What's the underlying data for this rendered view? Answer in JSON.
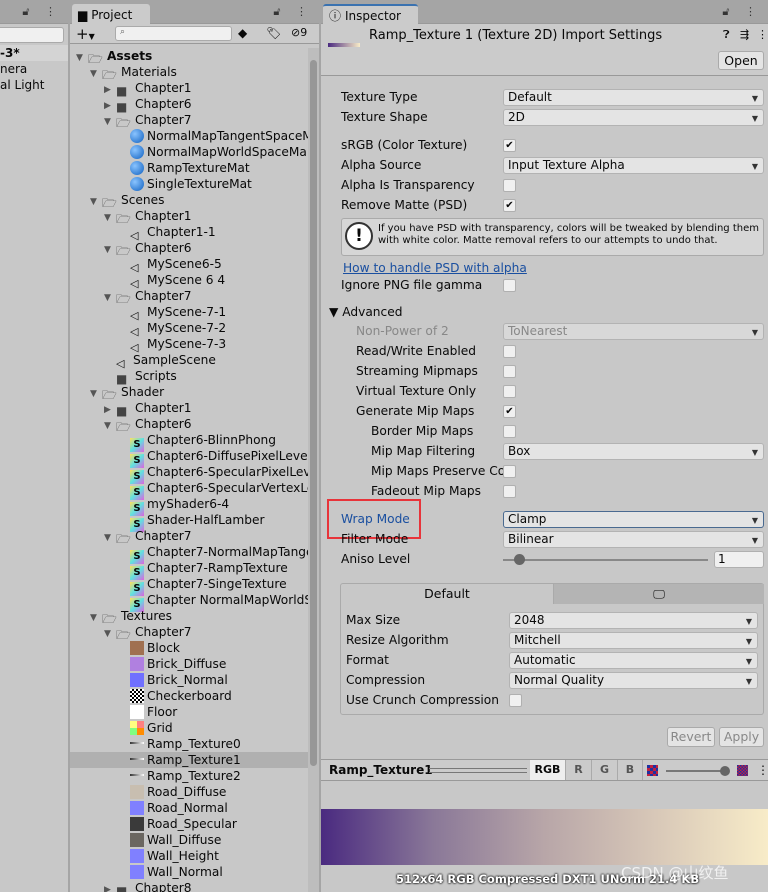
{
  "hierarchy": {
    "rows": [
      "-3*",
      "nera",
      "al Light"
    ]
  },
  "project": {
    "tab": "Project",
    "hidden_count": "9",
    "search_placeholder": "",
    "tree": [
      {
        "l": 0,
        "n": "Assets",
        "k": "folder",
        "o": true,
        "b": true
      },
      {
        "l": 1,
        "n": "Materials",
        "k": "folder",
        "o": true
      },
      {
        "l": 2,
        "n": "Chapter1",
        "k": "folder",
        "o": false
      },
      {
        "l": 2,
        "n": "Chapter6",
        "k": "folder",
        "o": false
      },
      {
        "l": 2,
        "n": "Chapter7",
        "k": "folder",
        "o": true
      },
      {
        "l": 3,
        "n": "NormalMapTangentSpaceM",
        "k": "mat"
      },
      {
        "l": 3,
        "n": "NormalMapWorldSpaceMa",
        "k": "mat"
      },
      {
        "l": 3,
        "n": "RampTextureMat",
        "k": "mat"
      },
      {
        "l": 3,
        "n": "SingleTextureMat",
        "k": "mat"
      },
      {
        "l": 1,
        "n": "Scenes",
        "k": "folder",
        "o": true
      },
      {
        "l": 2,
        "n": "Chapter1",
        "k": "folder",
        "o": true
      },
      {
        "l": 3,
        "n": "Chapter1-1",
        "k": "scene"
      },
      {
        "l": 2,
        "n": "Chapter6",
        "k": "folder",
        "o": true
      },
      {
        "l": 3,
        "n": "MyScene6-5",
        "k": "scene"
      },
      {
        "l": 3,
        "n": "MyScene 6 4",
        "k": "scene"
      },
      {
        "l": 2,
        "n": "Chapter7",
        "k": "folder",
        "o": true
      },
      {
        "l": 3,
        "n": "MyScene-7-1",
        "k": "scene"
      },
      {
        "l": 3,
        "n": "MyScene-7-2",
        "k": "scene"
      },
      {
        "l": 3,
        "n": "MyScene-7-3",
        "k": "scene"
      },
      {
        "l": 2,
        "n": "SampleScene",
        "k": "scene"
      },
      {
        "l": 2,
        "n": "Scripts",
        "k": "folder"
      },
      {
        "l": 1,
        "n": "Shader",
        "k": "folder",
        "o": true
      },
      {
        "l": 2,
        "n": "Chapter1",
        "k": "folder",
        "o": false
      },
      {
        "l": 2,
        "n": "Chapter6",
        "k": "folder",
        "o": true
      },
      {
        "l": 3,
        "n": "Chapter6-BlinnPhong",
        "k": "shader"
      },
      {
        "l": 3,
        "n": "Chapter6-DiffusePixelLevel",
        "k": "shader"
      },
      {
        "l": 3,
        "n": "Chapter6-SpecularPixelLeve",
        "k": "shader"
      },
      {
        "l": 3,
        "n": "Chapter6-SpecularVertexLev",
        "k": "shader"
      },
      {
        "l": 3,
        "n": "myShader6-4",
        "k": "shader"
      },
      {
        "l": 3,
        "n": "Shader-HalfLamber",
        "k": "shader"
      },
      {
        "l": 2,
        "n": "Chapter7",
        "k": "folder",
        "o": true
      },
      {
        "l": 3,
        "n": "Chapter7-NormalMapTange",
        "k": "shader"
      },
      {
        "l": 3,
        "n": "Chapter7-RampTexture",
        "k": "shader"
      },
      {
        "l": 3,
        "n": "Chapter7-SingeTexture",
        "k": "shader"
      },
      {
        "l": 3,
        "n": "Chapter NormalMapWorldS",
        "k": "shader"
      },
      {
        "l": 1,
        "n": "Textures",
        "k": "folder",
        "o": true
      },
      {
        "l": 2,
        "n": "Chapter7",
        "k": "folder",
        "o": true
      },
      {
        "l": 3,
        "n": "Block",
        "k": "tex",
        "c": "#a07050"
      },
      {
        "l": 3,
        "n": "Brick_Diffuse",
        "k": "tex",
        "c": "#b080e0"
      },
      {
        "l": 3,
        "n": "Brick_Normal",
        "k": "tex",
        "c": "#7070ff"
      },
      {
        "l": 3,
        "n": "Checkerboard",
        "k": "tex",
        "c": "checker"
      },
      {
        "l": 3,
        "n": "Floor",
        "k": "tex",
        "c": "#ffffff"
      },
      {
        "l": 3,
        "n": "Grid",
        "k": "tex",
        "c": "grid"
      },
      {
        "l": 3,
        "n": "Ramp_Texture0",
        "k": "ramp"
      },
      {
        "l": 3,
        "n": "Ramp_Texture1",
        "k": "ramp",
        "sel": true
      },
      {
        "l": 3,
        "n": "Ramp_Texture2",
        "k": "ramp"
      },
      {
        "l": 3,
        "n": "Road_Diffuse",
        "k": "tex",
        "c": "#c8beb0"
      },
      {
        "l": 3,
        "n": "Road_Normal",
        "k": "tex",
        "c": "#8080ff"
      },
      {
        "l": 3,
        "n": "Road_Specular",
        "k": "tex",
        "c": "#3a3a3a"
      },
      {
        "l": 3,
        "n": "Wall_Diffuse",
        "k": "tex",
        "c": "#6a6660"
      },
      {
        "l": 3,
        "n": "Wall_Height",
        "k": "tex",
        "c": "#8080ff"
      },
      {
        "l": 3,
        "n": "Wall_Normal",
        "k": "tex",
        "c": "#8080ff"
      },
      {
        "l": 2,
        "n": "Chapter8",
        "k": "folder",
        "o": false
      }
    ]
  },
  "inspector": {
    "tab": "Inspector",
    "title": "Ramp_Texture 1 (Texture 2D) Import Settings",
    "open_label": "Open",
    "fields": [
      {
        "label": "Texture Type",
        "type": "dd",
        "value": "Default"
      },
      {
        "label": "Texture Shape",
        "type": "dd",
        "value": "2D"
      },
      {
        "label": "sRGB (Color Texture)",
        "type": "cb",
        "checked": true
      },
      {
        "label": "Alpha Source",
        "type": "dd",
        "value": "Input Texture Alpha"
      },
      {
        "label": "Alpha Is Transparency",
        "type": "cb",
        "checked": false
      },
      {
        "label": "Remove Matte (PSD)",
        "type": "cb",
        "checked": true
      },
      {
        "label": "Ignore PNG file gamma",
        "type": "cb",
        "checked": false
      },
      {
        "label": "Advanced",
        "type": "foldout"
      },
      {
        "label": "Non-Power of 2",
        "type": "dd",
        "value": "ToNearest",
        "indent": 1,
        "disabled": true
      },
      {
        "label": "Read/Write Enabled",
        "type": "cb",
        "checked": false,
        "indent": 1
      },
      {
        "label": "Streaming Mipmaps",
        "type": "cb",
        "checked": false,
        "indent": 1
      },
      {
        "label": "Virtual Texture Only",
        "type": "cb",
        "checked": false,
        "indent": 1
      },
      {
        "label": "Generate Mip Maps",
        "type": "cb",
        "checked": true,
        "indent": 1
      },
      {
        "label": "Border Mip Maps",
        "type": "cb",
        "checked": false,
        "indent": 2
      },
      {
        "label": "Mip Map Filtering",
        "type": "dd",
        "value": "Box",
        "indent": 2
      },
      {
        "label": "Mip Maps Preserve Co",
        "type": "cb",
        "checked": false,
        "indent": 2
      },
      {
        "label": "Fadeout Mip Maps",
        "type": "cb",
        "checked": false,
        "indent": 2
      },
      {
        "label": "Wrap Mode",
        "type": "dd",
        "value": "Clamp",
        "highlight": true
      },
      {
        "label": "Filter Mode",
        "type": "dd",
        "value": "Bilinear"
      },
      {
        "label": "Aniso Level",
        "type": "slider",
        "value": "1"
      }
    ],
    "help_text": "If you have PSD with transparency, colors will be tweaked by blending them with white color. Matte removal refers to our attempts to undo that.",
    "help_link": "How to handle PSD with alpha",
    "platform": {
      "tabs": [
        "Default"
      ],
      "fields": [
        {
          "label": "Max Size",
          "value": "2048"
        },
        {
          "label": "Resize Algorithm",
          "value": "Mitchell"
        },
        {
          "label": "Format",
          "value": "Automatic"
        },
        {
          "label": "Compression",
          "value": "Normal Quality"
        },
        {
          "label": "Use Crunch Compression",
          "checkbox": true,
          "checked": false
        }
      ]
    },
    "revert_label": "Revert",
    "apply_label": "Apply",
    "preview": {
      "name": "Ramp_Texture1",
      "channels": [
        "RGB",
        "R",
        "G",
        "B"
      ],
      "info": "512x64  RGB Compressed DXT1 UNorm   21.4 KB",
      "ramp_colors": [
        "#4a2a80",
        "#8a7898",
        "#b8a6a8",
        "#d8c8b8",
        "#f8ecc8"
      ]
    },
    "highlight_color": "#e8343a",
    "link_color": "#1a4fa0"
  },
  "watermark": "CSDN @山纹鱼"
}
